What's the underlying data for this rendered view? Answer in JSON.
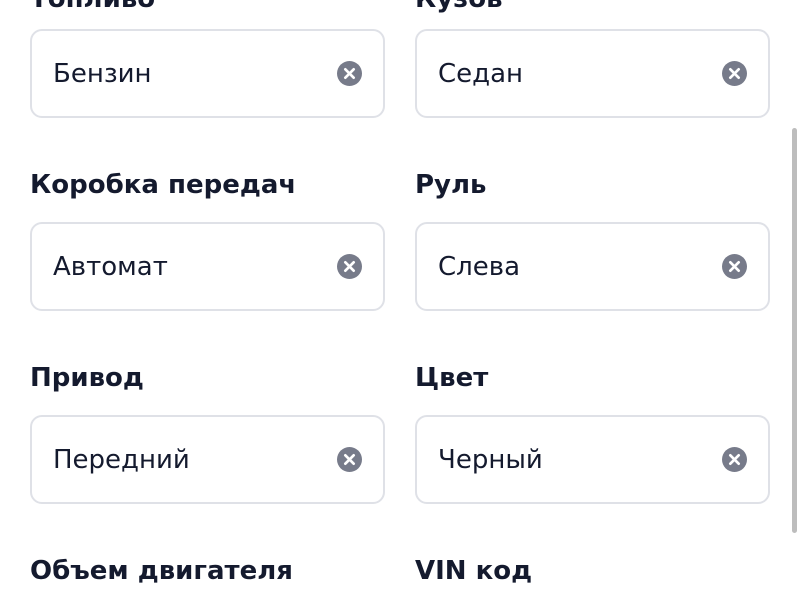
{
  "form": {
    "top_labels": {
      "left": "Топливо",
      "right": "Кузов"
    },
    "fuel_value": "Бензин",
    "body_value": "Седан",
    "gearbox_label": "Коробка передач",
    "gearbox_value": "Автомат",
    "steering_label": "Руль",
    "steering_value": "Слева",
    "drive_label": "Привод",
    "drive_value": "Передний",
    "color_label": "Цвет",
    "color_value": "Черный",
    "engine_label": "Объем двигателя",
    "vin_label": "VIN код"
  },
  "icons": {
    "clear": "close-circle-icon"
  },
  "colors": {
    "text": "#141a2e",
    "field_border": "#dfe1e7",
    "clear_icon": "#777b8a",
    "scrollbar": "#bdbdbd"
  }
}
